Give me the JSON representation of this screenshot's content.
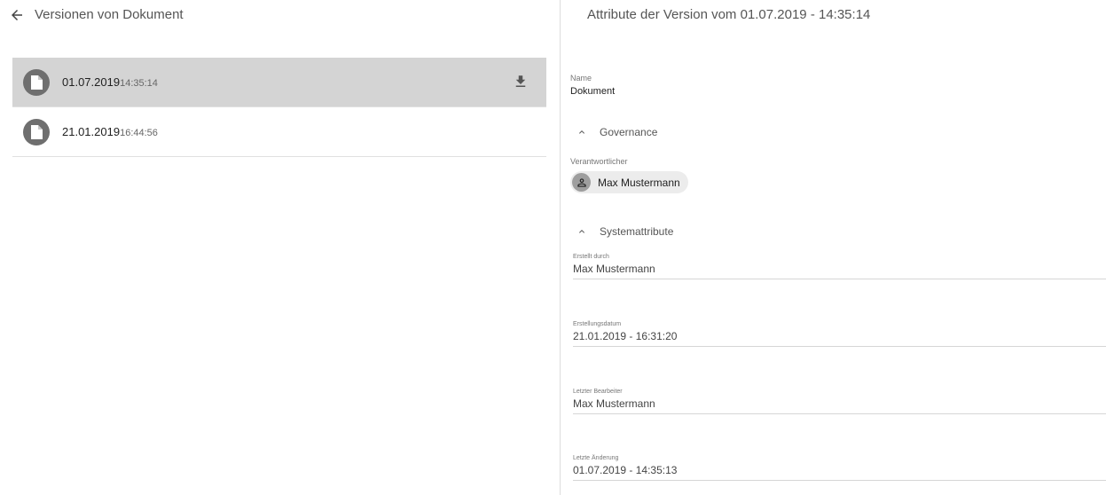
{
  "left": {
    "title": "Versionen von Dokument",
    "versions": [
      {
        "date": "01.07.2019",
        "time": "14:35:14",
        "selected": true
      },
      {
        "date": "21.01.2019",
        "time": "16:44:56",
        "selected": false
      }
    ]
  },
  "right": {
    "title": "Attribute der Version vom 01.07.2019 - 14:35:14",
    "name": {
      "label": "Name",
      "value": "Dokument"
    },
    "governance": {
      "label": "Governance",
      "responsible_label": "Verantwortlicher",
      "responsible_name": "Max Mustermann"
    },
    "system": {
      "label": "Systemattribute",
      "fields": [
        {
          "label": "Erstellt durch",
          "value": "Max Mustermann"
        },
        {
          "label": "Erstellungsdatum",
          "value": "21.01.2019 - 16:31:20"
        },
        {
          "label": "Letzter Bearbeiter",
          "value": "Max Mustermann"
        },
        {
          "label": "Letzte Änderung",
          "value": "01.07.2019 - 14:35:13"
        }
      ]
    }
  },
  "colors": {
    "selected_row": "#d4d4d4",
    "avatar": "#6f6f6f",
    "chip": "#ececec"
  },
  "icons": [
    "back-arrow-icon",
    "file-icon",
    "download-icon",
    "chevron-up-icon",
    "person-icon"
  ]
}
